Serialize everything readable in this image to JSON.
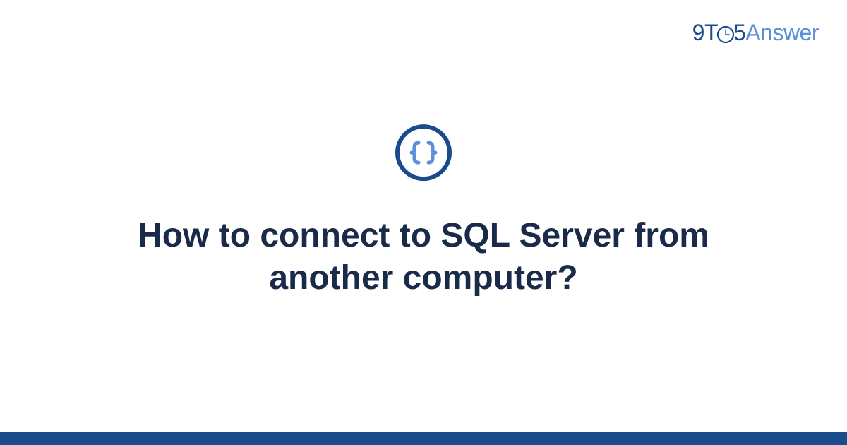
{
  "brand": {
    "part1": "9T",
    "part2": "5",
    "part3": "Answer"
  },
  "category_icon": "code-braces-icon",
  "title": "How to connect to SQL Server from another computer?",
  "colors": {
    "primary": "#1a4b8c",
    "accent": "#5b8fd6",
    "text": "#1a2b4a"
  }
}
